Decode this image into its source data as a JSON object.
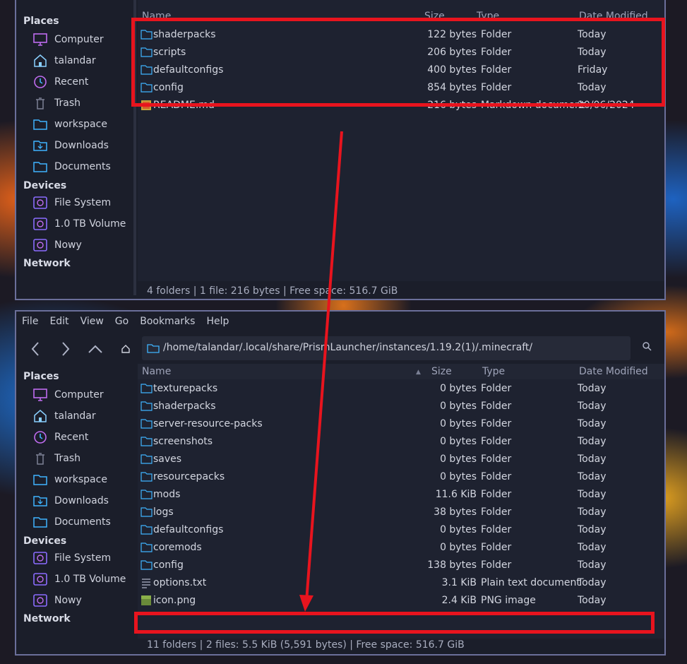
{
  "top_window": {
    "columns": {
      "name": "Name",
      "size": "Size",
      "type": "Type",
      "date": "Date Modified"
    },
    "files": [
      {
        "name": "shaderpacks",
        "size": "122 bytes",
        "type": "Folder",
        "date": "Today",
        "icon": "folder-icon"
      },
      {
        "name": "scripts",
        "size": "206 bytes",
        "type": "Folder",
        "date": "Today",
        "icon": "folder-icon"
      },
      {
        "name": "defaultconfigs",
        "size": "400 bytes",
        "type": "Folder",
        "date": "Friday",
        "icon": "folder-icon"
      },
      {
        "name": "config",
        "size": "854 bytes",
        "type": "Folder",
        "date": "Today",
        "icon": "folder-icon"
      },
      {
        "name": "README.md",
        "size": "216 bytes",
        "type": "Markdown document",
        "date": "10/06/2024",
        "icon": "markdown-file-icon"
      }
    ],
    "status": "4 folders | 1 file: 216 bytes | Free space: 516.7 GiB"
  },
  "bottom_window": {
    "menu": [
      "File",
      "Edit",
      "View",
      "Go",
      "Bookmarks",
      "Help"
    ],
    "path": "/home/talandar/.local/share/PrismLauncher/instances/1.19.2(1)/.minecraft/",
    "columns": {
      "name": "Name",
      "size": "Size",
      "type": "Type",
      "date": "Date Modified"
    },
    "files": [
      {
        "name": "texturepacks",
        "size": "0 bytes",
        "type": "Folder",
        "date": "Today",
        "icon": "folder-icon"
      },
      {
        "name": "shaderpacks",
        "size": "0 bytes",
        "type": "Folder",
        "date": "Today",
        "icon": "folder-icon"
      },
      {
        "name": "server-resource-packs",
        "size": "0 bytes",
        "type": "Folder",
        "date": "Today",
        "icon": "folder-icon"
      },
      {
        "name": "screenshots",
        "size": "0 bytes",
        "type": "Folder",
        "date": "Today",
        "icon": "folder-icon"
      },
      {
        "name": "saves",
        "size": "0 bytes",
        "type": "Folder",
        "date": "Today",
        "icon": "folder-icon"
      },
      {
        "name": "resourcepacks",
        "size": "0 bytes",
        "type": "Folder",
        "date": "Today",
        "icon": "folder-icon"
      },
      {
        "name": "mods",
        "size": "11.6 KiB",
        "type": "Folder",
        "date": "Today",
        "icon": "folder-icon"
      },
      {
        "name": "logs",
        "size": "38 bytes",
        "type": "Folder",
        "date": "Today",
        "icon": "folder-icon"
      },
      {
        "name": "defaultconfigs",
        "size": "0 bytes",
        "type": "Folder",
        "date": "Today",
        "icon": "folder-icon"
      },
      {
        "name": "coremods",
        "size": "0 bytes",
        "type": "Folder",
        "date": "Today",
        "icon": "folder-icon"
      },
      {
        "name": "config",
        "size": "138 bytes",
        "type": "Folder",
        "date": "Today",
        "icon": "folder-icon"
      },
      {
        "name": "options.txt",
        "size": "3.1 KiB",
        "type": "Plain text document",
        "date": "Today",
        "icon": "text-file-icon"
      },
      {
        "name": "icon.png",
        "size": "2.4 KiB",
        "type": "PNG image",
        "date": "Today",
        "icon": "image-file-icon"
      }
    ],
    "status": "11 folders | 2 files: 5.5 KiB (5,591 bytes) | Free space: 516.7 GiB"
  },
  "sidebar": {
    "places_title": "Places",
    "places": [
      {
        "label": "Computer",
        "icon": "computer-icon"
      },
      {
        "label": "talandar",
        "icon": "home-icon"
      },
      {
        "label": "Recent",
        "icon": "recent-icon"
      },
      {
        "label": "Trash",
        "icon": "trash-icon"
      },
      {
        "label": "workspace",
        "icon": "folder-icon"
      },
      {
        "label": "Downloads",
        "icon": "downloads-folder-icon"
      },
      {
        "label": "Documents",
        "icon": "documents-folder-icon"
      }
    ],
    "devices_title": "Devices",
    "devices": [
      {
        "label": "File System",
        "icon": "drive-icon"
      },
      {
        "label": "1.0 TB Volume",
        "icon": "drive-icon"
      },
      {
        "label": "Nowy",
        "icon": "drive-icon"
      }
    ],
    "network_title": "Network"
  },
  "colors": {
    "accent_purple": "#8b6cff",
    "accent_cyan": "#3fb4ff",
    "annotation_red": "#e8141e"
  }
}
